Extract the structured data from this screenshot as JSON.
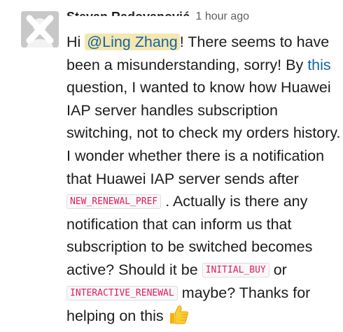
{
  "message": {
    "sender": "Stevan Radovanović",
    "time": "1 hour ago",
    "avatar_icon": "user-avatar-placeholder",
    "text_1": "Hi ",
    "mention": "@Ling Zhang",
    "text_2": "! There seems to have been a misunderstanding, sorry! By ",
    "link": "this",
    "text_3": " question, I wanted to know how Huawei IAP server handles subscription switching, not to check my orders history. I wonder whether there is a notification that Huawei IAP server sends after ",
    "code_1": "NEW_RENEWAL_PREF",
    "text_4": " . Actually is there any notification that can inform us that subscription to be switched becomes active? Should it be ",
    "code_2": "INITIAL_BUY",
    "text_5": " or ",
    "code_3": "INTERACTIVE_RENEWAL",
    "text_6": " maybe? Thanks for helping on this ",
    "emoji": "thumbs-up-icon"
  },
  "colors": {
    "link": "#1264a3",
    "mention_bg": "#f5e7b0",
    "code_text": "#e01e5a",
    "timestamp": "#616061"
  }
}
